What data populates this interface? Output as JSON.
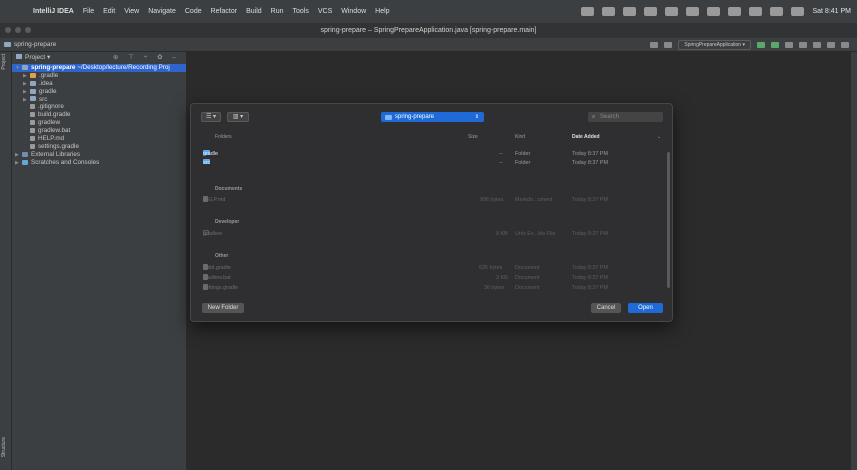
{
  "menubar": {
    "apple": "",
    "app_name": "IntelliJ IDEA",
    "items": [
      "File",
      "Edit",
      "View",
      "Navigate",
      "Code",
      "Refactor",
      "Build",
      "Run",
      "Tools",
      "VCS",
      "Window",
      "Help"
    ],
    "clock": "Sat 8:41 PM"
  },
  "window": {
    "title": "spring-prepare – SpringPrepareApplication.java [spring-prepare.main]"
  },
  "navbar": {
    "project_crumb": "spring-prepare",
    "run_config": "SpringPrepareApplication ▾"
  },
  "left_strip": {
    "project_tab": "Project",
    "structure_tab": "Structure"
  },
  "project_panel": {
    "header": "Project ▾",
    "tools": "⊕ ⊤ ÷ ✿ –",
    "root": "spring-prepare",
    "root_path": "~/Desktop/lecture/Recording Proj",
    "items": [
      {
        "label": ".gradle",
        "icon": "folder-orange-icon",
        "expandable": true
      },
      {
        "label": ".idea",
        "icon": "folder-icon",
        "expandable": true
      },
      {
        "label": "gradle",
        "icon": "folder-icon",
        "expandable": true
      },
      {
        "label": "src",
        "icon": "folder-icon",
        "expandable": true
      },
      {
        "label": ".gitignore",
        "icon": "file-icon",
        "expandable": false
      },
      {
        "label": "build.gradle",
        "icon": "gradle-file-icon",
        "expandable": false
      },
      {
        "label": "gradlew",
        "icon": "file-icon",
        "expandable": false
      },
      {
        "label": "gradlew.bat",
        "icon": "file-icon",
        "expandable": false
      },
      {
        "label": "HELP.md",
        "icon": "markdown-file-icon",
        "expandable": false
      },
      {
        "label": "settings.gradle",
        "icon": "gradle-file-icon",
        "expandable": false
      }
    ],
    "external_libraries": "External Libraries",
    "scratches": "Scratches and Consoles"
  },
  "dialog": {
    "location": "spring-prepare",
    "search_placeholder": "Search",
    "columns": {
      "name": "Folders",
      "size": "Size",
      "kind": "Kind",
      "date": "Date Added"
    },
    "folders": [
      {
        "name": "gradle",
        "size": "--",
        "kind": "Folder",
        "date": "Today 8:37 PM"
      },
      {
        "name": "src",
        "size": "--",
        "kind": "Folder",
        "date": "Today 8:37 PM"
      }
    ],
    "sections": {
      "documents": {
        "title": "Documents",
        "items": [
          {
            "name": "HELP.md",
            "size": "996 bytes",
            "kind": "Markdo...ument",
            "date": "Today 8:37 PM"
          }
        ]
      },
      "developer": {
        "title": "Developer",
        "items": [
          {
            "name": "gradlew",
            "size": "8 KB",
            "kind": "Unix Ex...ble File",
            "date": "Today 8:37 PM"
          }
        ]
      },
      "other": {
        "title": "Other",
        "items": [
          {
            "name": "build.gradle",
            "size": "635 bytes",
            "kind": "Document",
            "date": "Today 8:37 PM"
          },
          {
            "name": "gradlew.bat",
            "size": "3 KB",
            "kind": "Document",
            "date": "Today 8:37 PM"
          },
          {
            "name": "settings.gradle",
            "size": "36 bytes",
            "kind": "Document",
            "date": "Today 8:37 PM"
          }
        ]
      }
    },
    "new_folder": "New Folder",
    "cancel": "Cancel",
    "open": "Open"
  }
}
